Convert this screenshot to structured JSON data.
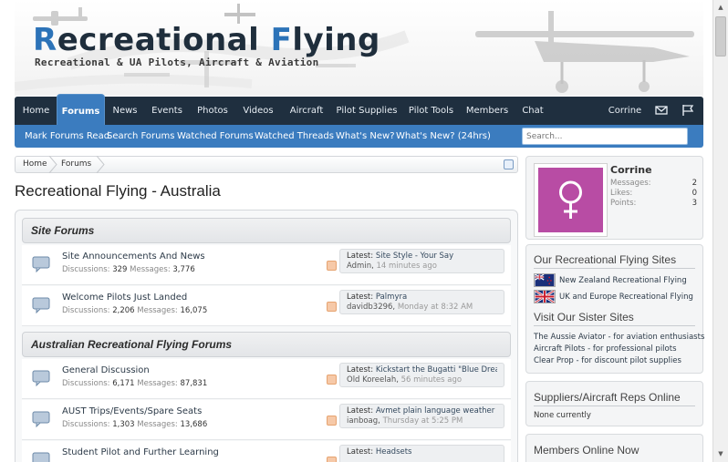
{
  "header": {
    "title_first_letter": "R",
    "title_mid": "ecreational ",
    "title_second_letter": "F",
    "title_end": "lying",
    "subtitle": "Recreational & UA Pilots, Aircraft & Aviation"
  },
  "nav": {
    "tabs": [
      {
        "label": "Home"
      },
      {
        "label": "Forums"
      },
      {
        "label": "News"
      },
      {
        "label": "Events"
      },
      {
        "label": "Photos"
      },
      {
        "label": "Videos"
      },
      {
        "label": "Aircraft"
      },
      {
        "label": "Pilot Supplies"
      },
      {
        "label": "Pilot Tools"
      },
      {
        "label": "Members"
      },
      {
        "label": "Chat"
      }
    ],
    "active_tab": "Forums",
    "user": "Corrine",
    "icons": [
      "envelope-icon",
      "flag-icon"
    ]
  },
  "subnav": {
    "links": [
      {
        "label": "Mark Forums Read"
      },
      {
        "label": "Search Forums"
      },
      {
        "label": "Watched Forums"
      },
      {
        "label": "Watched Threads"
      },
      {
        "label": "What's New?"
      },
      {
        "label": "What's New? (24hrs)"
      }
    ],
    "search_placeholder": "Search..."
  },
  "breadcrumb": [
    "Home",
    "Forums"
  ],
  "page_title": "Recreational Flying - Australia",
  "categories": [
    {
      "title": "Site Forums",
      "forums": [
        {
          "name": "Site Announcements And News",
          "discussions_label": "Discussions:",
          "discussions": "329",
          "messages_label": "Messages:",
          "messages": "3,776",
          "latest_label": "Latest:",
          "latest_title": "Site Style - Your Say",
          "latest_user": "Admin",
          "latest_time": "14 minutes ago"
        },
        {
          "name": "Welcome Pilots Just Landed",
          "discussions_label": "Discussions:",
          "discussions": "2,206",
          "messages_label": "Messages:",
          "messages": "16,075",
          "latest_label": "Latest:",
          "latest_title": "Palmyra",
          "latest_user": "davidb3296",
          "latest_time": "Monday at 8:32 AM"
        }
      ]
    },
    {
      "title": "Australian Recreational Flying Forums",
      "forums": [
        {
          "name": "General Discussion",
          "discussions_label": "Discussions:",
          "discussions": "6,171",
          "messages_label": "Messages:",
          "messages": "87,831",
          "latest_label": "Latest:",
          "latest_title": "Kickstart the Bugatti \"Blue Drea...",
          "latest_user": "Old Koreelah",
          "latest_time": "56 minutes ago"
        },
        {
          "name": "AUST Trips/Events/Spare Seats",
          "discussions_label": "Discussions:",
          "discussions": "1,303",
          "messages_label": "Messages:",
          "messages": "13,686",
          "latest_label": "Latest:",
          "latest_title": "Avmet plain language weather",
          "latest_user": "ianboag",
          "latest_time": "Thursday at 5:25 PM"
        },
        {
          "name": "Student Pilot and Further Learning",
          "discussions_label": "",
          "discussions": "",
          "messages_label": "",
          "messages": "",
          "latest_label": "Latest:",
          "latest_title": "Headsets",
          "latest_user": "",
          "latest_time": ""
        }
      ]
    }
  ],
  "visitor": {
    "name": "Corrine",
    "stats": [
      {
        "label": "Messages:",
        "value": "2"
      },
      {
        "label": "Likes:",
        "value": "0"
      },
      {
        "label": "Points:",
        "value": "3"
      }
    ]
  },
  "sites_box": {
    "title": "Our Recreational Flying Sites",
    "sites": [
      {
        "label": "New Zealand Recreational Flying",
        "flag": "nz-flag-icon"
      },
      {
        "label": "UK and Europe Recreational Flying",
        "flag": "uk-flag-icon"
      }
    ],
    "sister_title": "Visit Our Sister Sites",
    "sister_links": [
      {
        "label": "The Aussie Aviator - for aviation enthusiasts"
      },
      {
        "label": "Aircraft Pilots - for professional pilots"
      },
      {
        "label": "Clear Prop - for discount pilot supplies"
      }
    ]
  },
  "suppliers_box": {
    "title": "Suppliers/Aircraft Reps Online",
    "text": "None currently"
  },
  "members_online_box": {
    "title": "Members Online Now"
  },
  "colors": {
    "nav_bg": "#1f2f3f",
    "accent": "#3b7cbf",
    "avatar_bg": "#b84ca4"
  }
}
